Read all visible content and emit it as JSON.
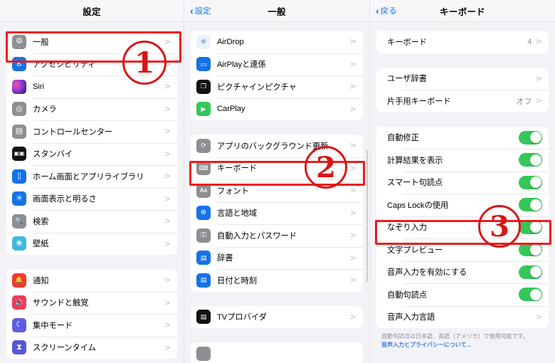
{
  "panel1": {
    "nav": {
      "title": "設定"
    },
    "groups": [
      {
        "rows": [
          {
            "label": "一般",
            "icon": "gear-icon",
            "color": "#8e8e93",
            "glyph": "⚙",
            "chevron": ">"
          },
          {
            "label": "アクセシビリティ",
            "icon": "accessibility-icon",
            "color": "#1572e8",
            "glyph": "♿",
            "chevron": ">"
          },
          {
            "label": "Siri",
            "icon": "siri-icon",
            "color": "#1c1c2e",
            "glyph": "◉",
            "chevron": ">"
          },
          {
            "label": "カメラ",
            "icon": "camera-icon",
            "color": "#8e8e93",
            "glyph": "◎",
            "chevron": ">"
          },
          {
            "label": "コントロールセンター",
            "icon": "control-center-icon",
            "color": "#8e8e93",
            "glyph": "▤",
            "chevron": ">"
          },
          {
            "label": "スタンバイ",
            "icon": "standby-icon",
            "color": "#111111",
            "glyph": "▣",
            "chevron": ">"
          },
          {
            "label": "ホーム画面とアプリライブラリ",
            "icon": "home-screen-icon",
            "color": "#1572e8",
            "glyph": "▢",
            "chevron": ">"
          },
          {
            "label": "画面表示と明るさ",
            "icon": "display-brightness-icon",
            "color": "#1572e8",
            "glyph": "☀",
            "chevron": ">"
          },
          {
            "label": "検索",
            "icon": "search-icon",
            "color": "#8e8e93",
            "glyph": "🔍",
            "chevron": ">"
          },
          {
            "label": "壁紙",
            "icon": "wallpaper-icon",
            "color": "#41b7e0",
            "glyph": "❀",
            "chevron": ">"
          }
        ]
      },
      {
        "rows": [
          {
            "label": "通知",
            "icon": "notification-bell-icon",
            "color": "#f03a2e",
            "glyph": "🔔",
            "chevron": ">"
          },
          {
            "label": "サウンドと触覚",
            "icon": "sound-haptics-icon",
            "color": "#ef3b5b",
            "glyph": "🔊",
            "chevron": ">"
          },
          {
            "label": "集中モード",
            "icon": "focus-moon-icon",
            "color": "#5e5ce6",
            "glyph": "☾",
            "chevron": ">"
          },
          {
            "label": "スクリーンタイム",
            "icon": "screen-time-icon",
            "color": "#5756d5",
            "glyph": "⧗",
            "chevron": ">"
          }
        ]
      }
    ]
  },
  "panel2": {
    "nav": {
      "back": "設定",
      "back_chevron": "‹",
      "title": "一般"
    },
    "groups": [
      {
        "rows": [
          {
            "label": "AirDrop",
            "icon": "airdrop-icon",
            "color": "#e9f1fb",
            "glyph": "◈",
            "chevron": ">"
          },
          {
            "label": "AirPlayと連係",
            "icon": "airplay-icon",
            "color": "#1572e8",
            "glyph": "▭",
            "chevron": ">"
          },
          {
            "label": "ピクチャインピクチャ",
            "icon": "picture-in-picture-icon",
            "color": "#121212",
            "glyph": "❐",
            "chevron": ">"
          },
          {
            "label": "CarPlay",
            "icon": "carplay-icon",
            "color": "#35c759",
            "glyph": "▶",
            "chevron": ">"
          }
        ]
      },
      {
        "rows": [
          {
            "label": "アプリのバックグラウンド更新",
            "icon": "app-refresh-icon",
            "color": "#8e8e93",
            "glyph": "⟳",
            "chevron": ">"
          },
          {
            "label": "キーボード",
            "icon": "keyboard-icon",
            "color": "#8e8e93",
            "glyph": "⌨",
            "chevron": ">"
          },
          {
            "label": "フォント",
            "icon": "font-icon",
            "color": "#8e8e93",
            "glyph": "Aa",
            "chevron": ">"
          },
          {
            "label": "言語と地域",
            "icon": "language-region-icon",
            "color": "#1572e8",
            "glyph": "🌐",
            "chevron": ">"
          },
          {
            "label": "自動入力とパスワード",
            "icon": "autofill-password-icon",
            "color": "#8e8e93",
            "glyph": "⚿",
            "chevron": ">"
          },
          {
            "label": "辞書",
            "icon": "dictionary-icon",
            "color": "#1572e8",
            "glyph": "📘",
            "chevron": ">"
          },
          {
            "label": "日付と時刻",
            "icon": "date-time-icon",
            "color": "#1572e8",
            "glyph": "▤",
            "chevron": ">"
          }
        ]
      },
      {
        "rows": [
          {
            "label": "TVプロバイダ",
            "icon": "tv-provider-icon",
            "color": "#111111",
            "glyph": "▤",
            "chevron": ">"
          }
        ]
      },
      {
        "rows": [
          {
            "label": "",
            "icon": "partial-row-icon",
            "color": "#8e8e93",
            "glyph": "",
            "chevron": ""
          }
        ]
      }
    ]
  },
  "panel3": {
    "nav": {
      "back": "戻る",
      "back_chevron": "‹",
      "title": "キーボード"
    },
    "groups": [
      {
        "rows": [
          {
            "label": "キーボード",
            "type": "value",
            "value": "4",
            "chevron": ">"
          }
        ]
      },
      {
        "rows": [
          {
            "label": "ユーザ辞書",
            "type": "chevron",
            "value": "",
            "chevron": ">"
          },
          {
            "label": "片手用キーボード",
            "type": "value",
            "value": "オフ",
            "chevron": ">"
          }
        ]
      },
      {
        "rows": [
          {
            "label": "自動修正",
            "type": "toggle",
            "on": true
          },
          {
            "label": "計算結果を表示",
            "type": "toggle",
            "on": true
          },
          {
            "label": "スマート句読点",
            "type": "toggle",
            "on": true
          },
          {
            "label": "Caps Lockの使用",
            "type": "toggle",
            "on": true
          },
          {
            "label": "なぞり入力",
            "type": "toggle",
            "on": true
          },
          {
            "label": "文字プレビュー",
            "type": "toggle",
            "on": true
          },
          {
            "label": "音声入力を有効にする",
            "type": "toggle",
            "on": true
          },
          {
            "label": "自動句読点",
            "type": "toggle",
            "on": true
          },
          {
            "label": "音声入力言語",
            "type": "chevron",
            "value": "",
            "chevron": ">"
          }
        ]
      }
    ],
    "note": {
      "text": "自動句読点は日本語、英語（アメリカ）で使用可能です。",
      "link": "音声入力とプライバシーについて..."
    }
  },
  "annotations": {
    "highlight_color": "#ec1c1c",
    "steps": [
      {
        "number": "①",
        "digit": "1",
        "target": "一般"
      },
      {
        "number": "②",
        "digit": "2",
        "target": "キーボード"
      },
      {
        "number": "③",
        "digit": "3",
        "target": "なぞり入力"
      }
    ]
  }
}
